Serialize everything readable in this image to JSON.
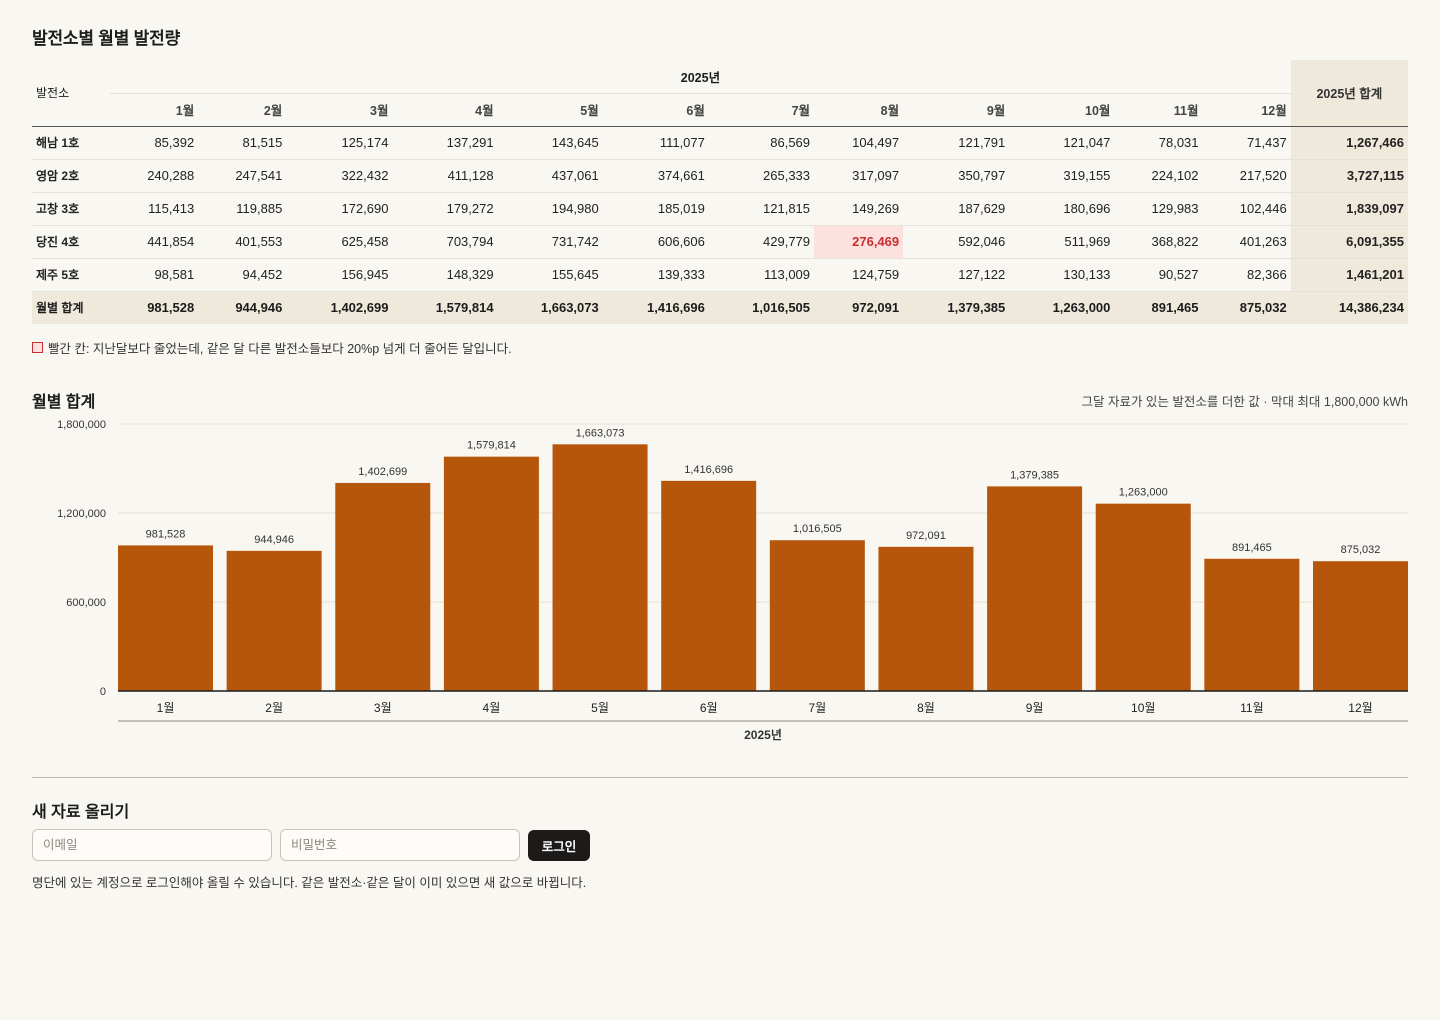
{
  "page": {
    "title": "발전소별 월별 발전량"
  },
  "table": {
    "year": "2025년",
    "plant_header": "발전소",
    "total_header": "2025년 합계",
    "months": [
      "1월",
      "2월",
      "3월",
      "4월",
      "5월",
      "6월",
      "7월",
      "8월",
      "9월",
      "10월",
      "11월",
      "12월"
    ],
    "rows": [
      {
        "name": "해남 1호",
        "values": [
          "85,392",
          "81,515",
          "125,174",
          "137,291",
          "143,645",
          "111,077",
          "86,569",
          "104,497",
          "121,791",
          "121,047",
          "78,031",
          "71,437"
        ],
        "total": "1,267,466",
        "flagged": []
      },
      {
        "name": "영암 2호",
        "values": [
          "240,288",
          "247,541",
          "322,432",
          "411,128",
          "437,061",
          "374,661",
          "265,333",
          "317,097",
          "350,797",
          "319,155",
          "224,102",
          "217,520"
        ],
        "total": "3,727,115",
        "flagged": []
      },
      {
        "name": "고창 3호",
        "values": [
          "115,413",
          "119,885",
          "172,690",
          "179,272",
          "194,980",
          "185,019",
          "121,815",
          "149,269",
          "187,629",
          "180,696",
          "129,983",
          "102,446"
        ],
        "total": "1,839,097",
        "flagged": []
      },
      {
        "name": "당진 4호",
        "values": [
          "441,854",
          "401,553",
          "625,458",
          "703,794",
          "731,742",
          "606,606",
          "429,779",
          "276,469",
          "592,046",
          "511,969",
          "368,822",
          "401,263"
        ],
        "total": "6,091,355",
        "flagged": [
          7
        ]
      },
      {
        "name": "제주 5호",
        "values": [
          "98,581",
          "94,452",
          "156,945",
          "148,329",
          "155,645",
          "139,333",
          "113,009",
          "124,759",
          "127,122",
          "130,133",
          "90,527",
          "82,366"
        ],
        "total": "1,461,201",
        "flagged": []
      }
    ],
    "sum_row": {
      "name": "월별 합계",
      "values": [
        "981,528",
        "944,946",
        "1,402,699",
        "1,579,814",
        "1,663,073",
        "1,416,696",
        "1,016,505",
        "972,091",
        "1,379,385",
        "1,263,000",
        "891,465",
        "875,032"
      ],
      "total": "14,386,234"
    }
  },
  "legend_note": "빨간 칸: 지난달보다 줄었는데, 같은 달 다른 발전소들보다 20%p 넘게 더 줄어든 달입니다.",
  "chart_section": {
    "title": "월별 합계",
    "note": "그달 자료가 있는 발전소를 더한 값 · 막대 최대 1,800,000 kWh"
  },
  "chart_data": {
    "type": "bar",
    "categories": [
      "1월",
      "2월",
      "3월",
      "4월",
      "5월",
      "6월",
      "7월",
      "8월",
      "9월",
      "10월",
      "11월",
      "12월"
    ],
    "values": [
      981528,
      944946,
      1402699,
      1579814,
      1663073,
      1416696,
      1016505,
      972091,
      1379385,
      1263000,
      891465,
      875032
    ],
    "value_labels": [
      "981,528",
      "944,946",
      "1,402,699",
      "1,579,814",
      "1,663,073",
      "1,416,696",
      "1,016,505",
      "972,091",
      "1,379,385",
      "1,263,000",
      "891,465",
      "875,032"
    ],
    "ylim": [
      0,
      1800000
    ],
    "yticks": [
      0,
      600000,
      1200000,
      1800000
    ],
    "ytick_labels": [
      "0",
      "600,000",
      "1,200,000",
      "1,800,000"
    ],
    "group_label": "2025년",
    "bar_color": "#b5560a",
    "grid": true
  },
  "upload": {
    "title": "새 자료 올리기",
    "email_placeholder": "이메일",
    "password_placeholder": "비밀번호",
    "login_label": "로그인",
    "note": "명단에 있는 계정으로 로그인해야 올릴 수 있습니다. 같은 발전소·같은 달이 이미 있으면 새 값으로 바뀝니다."
  }
}
